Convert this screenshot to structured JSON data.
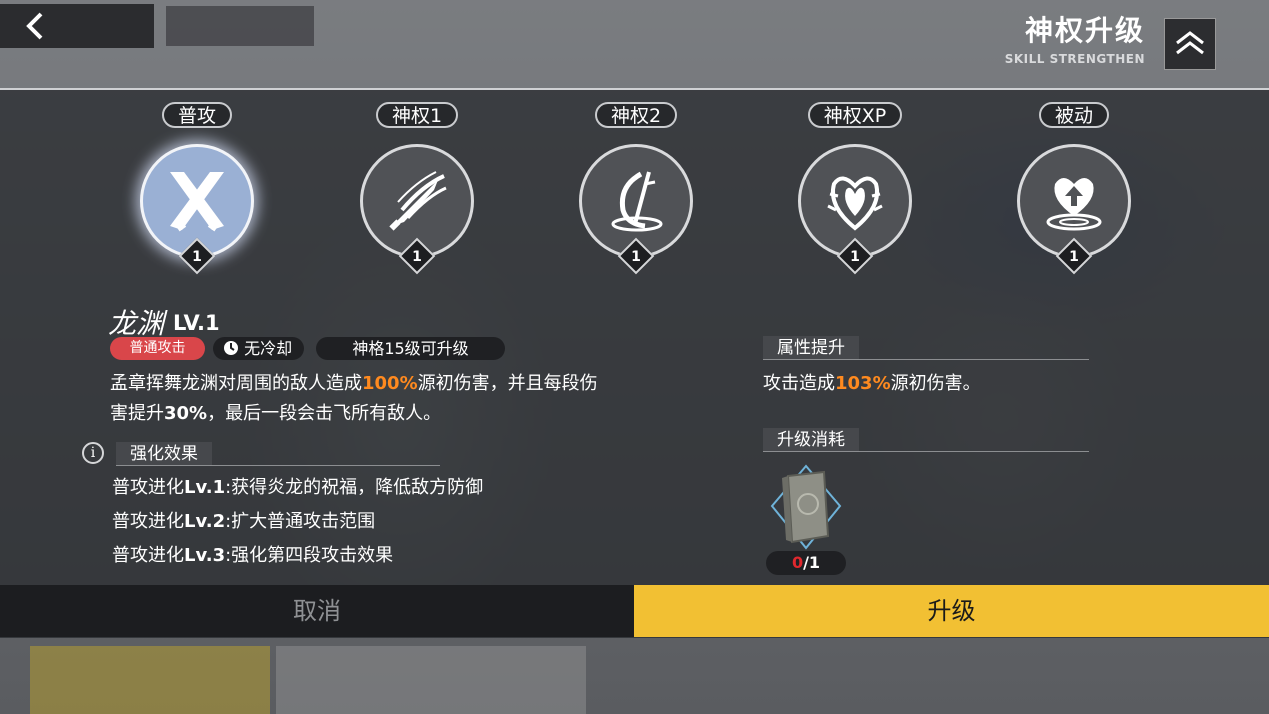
{
  "header": {
    "title": "神权升级",
    "subtitle": "SKILL STRENGTHEN"
  },
  "skills": [
    {
      "tag": "普攻",
      "level": "1",
      "icon": "crossed-blades-icon",
      "active": true
    },
    {
      "tag": "神权1",
      "level": "1",
      "icon": "sword-slash-icon",
      "active": false
    },
    {
      "tag": "神权2",
      "level": "1",
      "icon": "spiral-sword-icon",
      "active": false
    },
    {
      "tag": "神权XP",
      "level": "1",
      "icon": "flame-heart-icon",
      "active": false
    },
    {
      "tag": "被动",
      "level": "1",
      "icon": "heart-up-icon",
      "active": false
    }
  ],
  "detail": {
    "name": "龙渊",
    "level": "LV.1",
    "type_badge": "普通攻击",
    "cooldown": "无冷却",
    "unlock": "神格15级可升级",
    "desc_1": "孟章挥舞龙渊对周围的敌人造成",
    "desc_pct": "100%",
    "desc_2": "源初伤害，并且每段伤",
    "desc_3": "害提升",
    "desc_pct2": "30%",
    "desc_4": "，最后一段会击飞所有敌人。",
    "enhance_title": "强化效果",
    "enhance": [
      {
        "prefix": "普攻进化",
        "lv": "Lv.1",
        "text": ":获得炎龙的祝福，降低敌方防御"
      },
      {
        "prefix": "普攻进化",
        "lv": "Lv.2",
        "text": ":扩大普通攻击范围"
      },
      {
        "prefix": "普攻进化",
        "lv": "Lv.3",
        "text": ":强化第四段攻击效果"
      }
    ]
  },
  "attribute": {
    "title": "属性提升",
    "text_1": "攻击造成",
    "pct": "103%",
    "text_2": "源初伤害。"
  },
  "cost": {
    "title": "升级消耗",
    "item_icon": "skill-book-icon",
    "have": "0",
    "need": "/1"
  },
  "buttons": {
    "cancel": "取消",
    "upgrade": "升级"
  },
  "colors": {
    "accent": "#f2c033",
    "highlight": "#ff8a1f",
    "badge_red": "#d9464a"
  }
}
